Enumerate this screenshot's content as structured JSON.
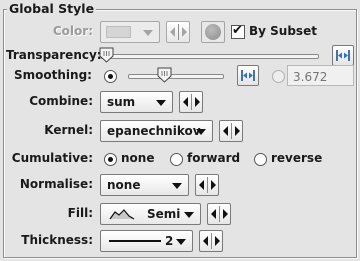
{
  "panel": {
    "title": "Global Style"
  },
  "color": {
    "label": "Color:",
    "subset_checkbox_label": "By Subset",
    "subset_checked": true
  },
  "transparency": {
    "label": "Transparency:",
    "level": 0.0
  },
  "smoothing": {
    "label": "Smoothing:",
    "slider_level": 0.33,
    "value_placeholder": "3.672"
  },
  "combine": {
    "label": "Combine:",
    "selected": "sum"
  },
  "kernel": {
    "label": "Kernel:",
    "selected": "epanechnikov"
  },
  "cumulative": {
    "label": "Cumulative:",
    "options": [
      "none",
      "forward",
      "reverse"
    ],
    "selected": "none"
  },
  "normalise": {
    "label": "Normalise:",
    "selected": "none"
  },
  "fill": {
    "label": "Fill:",
    "selected": "Semi",
    "icon": "semi-fill-icon"
  },
  "thickness": {
    "label": "Thickness:",
    "selected": "2",
    "icon": "line-icon"
  }
}
